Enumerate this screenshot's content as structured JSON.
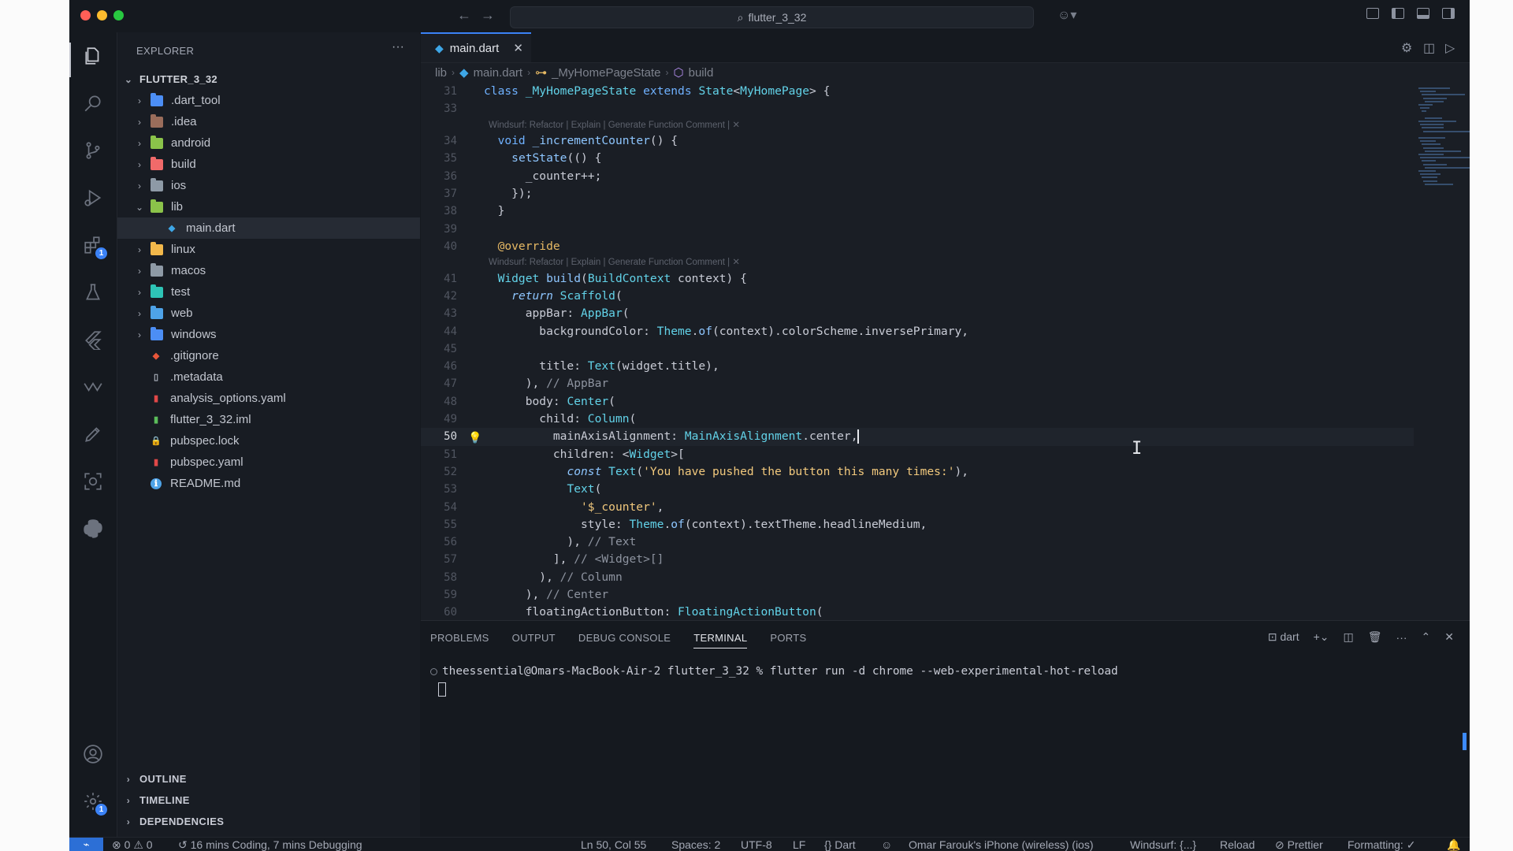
{
  "window": {
    "title": "flutter_3_32"
  },
  "colors": {
    "accent": "#3b82f6",
    "background": "#1a1e25",
    "sidebar": "#181c23",
    "keyword": "#6fb1ff",
    "type": "#62d2e8",
    "string": "#f2c97d",
    "annotation": "#e6b964"
  },
  "activity": {
    "extensions_badge": "1",
    "settings_badge": "1"
  },
  "explorer": {
    "title": "EXPLORER",
    "more": "···",
    "root": "FLUTTER_3_32",
    "items": [
      {
        "name": ".dart_tool",
        "type": "folder",
        "color": "#4c8ef5",
        "expanded": false
      },
      {
        "name": ".idea",
        "type": "folder",
        "color": "#9a6d5b",
        "expanded": false
      },
      {
        "name": "android",
        "type": "folder",
        "color": "#8bc34a",
        "expanded": false
      },
      {
        "name": "build",
        "type": "folder",
        "color": "#f06a6a",
        "expanded": false
      },
      {
        "name": "ios",
        "type": "folder",
        "color": "#8e9aa6",
        "expanded": false
      },
      {
        "name": "lib",
        "type": "folder",
        "color": "#8bc34a",
        "expanded": true
      },
      {
        "name": "main.dart",
        "type": "dart",
        "color": "#3ea6e6",
        "selected": true
      },
      {
        "name": "linux",
        "type": "folder",
        "color": "#f2b84b",
        "expanded": false
      },
      {
        "name": "macos",
        "type": "folder",
        "color": "#8e9aa6",
        "expanded": false
      },
      {
        "name": "test",
        "type": "folder",
        "color": "#2ec4b6",
        "expanded": false
      },
      {
        "name": "web",
        "type": "folder",
        "color": "#4ea3e8",
        "expanded": false
      },
      {
        "name": "windows",
        "type": "folder",
        "color": "#4c8ef5",
        "expanded": false
      },
      {
        "name": ".gitignore",
        "type": "git",
        "color": "#e8563a"
      },
      {
        "name": ".metadata",
        "type": "file",
        "color": "#aab0bb"
      },
      {
        "name": "analysis_options.yaml",
        "type": "yaml",
        "color": "#e04848"
      },
      {
        "name": "flutter_3_32.iml",
        "type": "iml",
        "color": "#5bbd5b"
      },
      {
        "name": "pubspec.lock",
        "type": "lock",
        "color": "#f2c23e"
      },
      {
        "name": "pubspec.yaml",
        "type": "yaml",
        "color": "#e04848"
      },
      {
        "name": "README.md",
        "type": "info",
        "color": "#4ea3e8"
      }
    ],
    "sections": [
      "OUTLINE",
      "TIMELINE",
      "DEPENDENCIES"
    ]
  },
  "editor": {
    "tab_label": "main.dart",
    "breadcrumb": [
      "lib",
      "main.dart",
      "_MyHomePageState",
      "build"
    ],
    "lens_text": "Windsurf: Refactor | Explain | Generate Function Comment | ✕",
    "lines": [
      {
        "n": "31",
        "html": "<span class=\"kw\">class</span> <span class=\"ty\">_MyHomePageState</span> <span class=\"kw\">extends</span> <span class=\"ty\">State</span>&lt;<span class=\"ty\">MyHomePage</span>&gt; {"
      },
      {
        "n": "33",
        "html": ""
      },
      {
        "lens": true
      },
      {
        "n": "34",
        "html": "  <span class=\"kw\">void</span> <span class=\"fn\">_incrementCounter</span>() {"
      },
      {
        "n": "35",
        "html": "    <span class=\"fn\">setState</span>(() {"
      },
      {
        "n": "36",
        "html": "      _counter++;"
      },
      {
        "n": "37",
        "html": "    });"
      },
      {
        "n": "38",
        "html": "  }"
      },
      {
        "n": "39",
        "html": ""
      },
      {
        "n": "40",
        "html": "  <span class=\"an\">@override</span>"
      },
      {
        "lens": true
      },
      {
        "n": "41",
        "html": "  <span class=\"ty\">Widget</span> <span class=\"fn\">build</span>(<span class=\"ty\">BuildContext</span> context) {"
      },
      {
        "n": "42",
        "html": "    <span class=\"it\">return</span> <span class=\"ty\">Scaffold</span>("
      },
      {
        "n": "43",
        "html": "      appBar: <span class=\"ty\">AppBar</span>("
      },
      {
        "n": "44",
        "html": "        backgroundColor: <span class=\"ty\">Theme</span>.<span class=\"fn\">of</span>(context).colorScheme.inversePrimary,"
      },
      {
        "n": "45",
        "html": ""
      },
      {
        "n": "46",
        "html": "        title: <span class=\"ty\">Text</span>(widget.title),"
      },
      {
        "n": "47",
        "html": "      ), <span class=\"cm\">// AppBar</span>"
      },
      {
        "n": "48",
        "html": "      body: <span class=\"ty\">Center</span>("
      },
      {
        "n": "49",
        "html": "        child: <span class=\"ty\">Column</span>("
      },
      {
        "n": "50",
        "html": "          mainAxisAlignment: <span class=\"ty\">MainAxisAlignment</span>.center,<span class=\"cursor\"></span>",
        "current": true
      },
      {
        "n": "51",
        "html": "          children: &lt;<span class=\"ty\">Widget</span>&gt;["
      },
      {
        "n": "52",
        "html": "            <span class=\"it\">const</span> <span class=\"ty\">Text</span>(<span class=\"str\">'You have pushed the button this many times:'</span>),"
      },
      {
        "n": "53",
        "html": "            <span class=\"ty\">Text</span>("
      },
      {
        "n": "54",
        "html": "              <span class=\"str\">'$_counter'</span>,"
      },
      {
        "n": "55",
        "html": "              style: <span class=\"ty\">Theme</span>.<span class=\"fn\">of</span>(context).textTheme.headlineMedium,"
      },
      {
        "n": "56",
        "html": "            ), <span class=\"cm\">// Text</span>"
      },
      {
        "n": "57",
        "html": "          ], <span class=\"cm\">// &lt;Widget&gt;[]</span>"
      },
      {
        "n": "58",
        "html": "        ), <span class=\"cm\">// Column</span>"
      },
      {
        "n": "59",
        "html": "      ), <span class=\"cm\">// Center</span>"
      },
      {
        "n": "60",
        "html": "      floatingActionButton: <span class=\"ty\">FloatingActionButton</span>("
      }
    ]
  },
  "panel": {
    "tabs": [
      "PROBLEMS",
      "OUTPUT",
      "DEBUG CONSOLE",
      "TERMINAL",
      "PORTS"
    ],
    "active_tab": "TERMINAL",
    "terminal_name": "dart",
    "terminal_line": "theessential@Omars-MacBook-Air-2 flutter_3_32 % flutter run -d chrome --web-experimental-hot-reload"
  },
  "statusbar": {
    "errors": "0",
    "warnings": "0",
    "time": "16 mins Coding, 7 mins Debugging",
    "position": "Ln 50, Col 55",
    "spaces": "Spaces: 2",
    "encoding": "UTF-8",
    "eol": "LF",
    "language": "Dart",
    "device": "Omar Farouk's iPhone (wireless) (ios)",
    "windsurf": "Windsurf: {...}",
    "reload": "Reload",
    "prettier": "Prettier",
    "formatting": "Formatting: ✓"
  }
}
